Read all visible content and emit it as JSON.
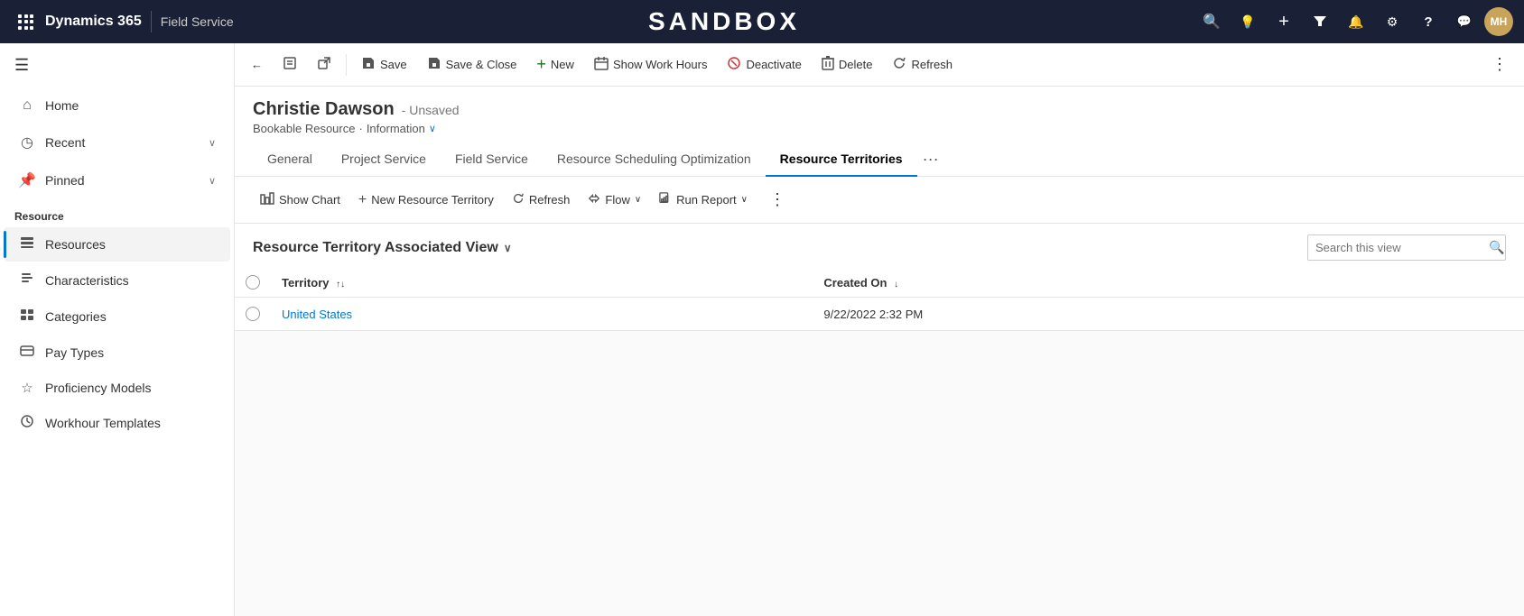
{
  "topNav": {
    "brandTitle": "Dynamics 365",
    "appTitle": "Field Service",
    "sandboxLabel": "SANDBOX",
    "avatarInitials": "MH",
    "icons": {
      "search": "🔍",
      "bulb": "💡",
      "plus": "+",
      "filter": "⊿",
      "bell": "🔔",
      "settings": "⚙",
      "help": "?",
      "chat": "💬"
    }
  },
  "sidebar": {
    "navItems": [
      {
        "id": "home",
        "label": "Home",
        "icon": "⌂"
      },
      {
        "id": "recent",
        "label": "Recent",
        "icon": "◷",
        "hasChevron": true
      },
      {
        "id": "pinned",
        "label": "Pinned",
        "icon": "📌",
        "hasChevron": true
      }
    ],
    "sectionLabel": "Resource",
    "resourceItems": [
      {
        "id": "resources",
        "label": "Resources",
        "icon": "👤",
        "active": true
      },
      {
        "id": "characteristics",
        "label": "Characteristics",
        "icon": "📋"
      },
      {
        "id": "categories",
        "label": "Categories",
        "icon": "📊"
      },
      {
        "id": "pay-types",
        "label": "Pay Types",
        "icon": "📄"
      },
      {
        "id": "proficiency-models",
        "label": "Proficiency Models",
        "icon": "☆"
      },
      {
        "id": "workhour-templates",
        "label": "Workhour Templates",
        "icon": "⏱"
      }
    ]
  },
  "toolbar": {
    "backLabel": "←",
    "saveLabel": "Save",
    "saveCloseLabel": "Save & Close",
    "newLabel": "New",
    "showWorkHoursLabel": "Show Work Hours",
    "deactivateLabel": "Deactivate",
    "deleteLabel": "Delete",
    "refreshLabel": "Refresh"
  },
  "record": {
    "name": "Christie Dawson",
    "unsaved": "- Unsaved",
    "breadcrumb": "Bookable Resource",
    "breadcrumbView": "Information"
  },
  "tabs": [
    {
      "id": "general",
      "label": "General",
      "active": false
    },
    {
      "id": "project-service",
      "label": "Project Service",
      "active": false
    },
    {
      "id": "field-service",
      "label": "Field Service",
      "active": false
    },
    {
      "id": "rso",
      "label": "Resource Scheduling Optimization",
      "active": false
    },
    {
      "id": "resource-territories",
      "label": "Resource Territories",
      "active": true
    }
  ],
  "subToolbar": {
    "showChartLabel": "Show Chart",
    "newResourceTerritoryLabel": "New Resource Territory",
    "refreshLabel": "Refresh",
    "flowLabel": "Flow",
    "runReportLabel": "Run Report"
  },
  "view": {
    "title": "Resource Territory Associated View",
    "searchPlaceholder": "Search this view"
  },
  "table": {
    "columns": [
      {
        "id": "territory",
        "label": "Territory",
        "sortable": true,
        "sortDir": "asc"
      },
      {
        "id": "createdOn",
        "label": "Created On",
        "sortable": true,
        "sortDir": "desc"
      }
    ],
    "rows": [
      {
        "territory": "United States",
        "createdOn": "9/22/2022 2:32 PM"
      }
    ]
  }
}
